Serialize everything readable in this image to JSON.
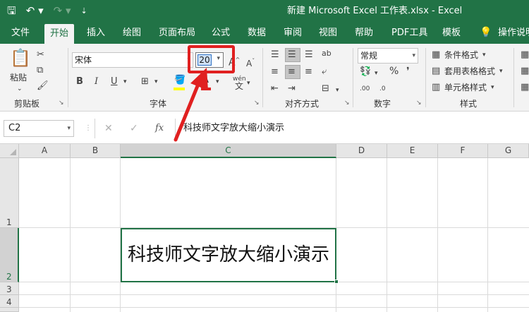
{
  "titlebar": {
    "title": "新建 Microsoft Excel 工作表.xlsx  -  Excel",
    "save_icon": "save-icon",
    "undo_icon": "undo-icon",
    "redo_icon": "redo-icon",
    "customize_icon": "customize-qat-icon"
  },
  "tabs": {
    "file": "文件",
    "home": "开始",
    "insert": "插入",
    "draw": "绘图",
    "layout": "页面布局",
    "formulas": "公式",
    "data": "数据",
    "review": "审阅",
    "view": "视图",
    "help": "帮助",
    "pdf": "PDF工具",
    "templates": "模板",
    "tell_me": "操作说明"
  },
  "ribbon": {
    "clipboard": {
      "paste": "粘贴",
      "label": "剪贴板"
    },
    "font": {
      "font_name": "宋体",
      "font_size": "20",
      "bold": "B",
      "italic": "I",
      "underline": "U",
      "grow": "A",
      "shrink": "A",
      "font_color": "A",
      "phonetic": "wén",
      "label": "字体"
    },
    "alignment": {
      "label": "对齐方式",
      "wrap": "ab"
    },
    "number": {
      "format": "常规",
      "percent": "%",
      "label": "数字",
      "inc_decimal": ".00",
      "dec_decimal": ".0"
    },
    "styles": {
      "conditional": "条件格式",
      "table": "套用表格格式",
      "cell_styles": "单元格样式",
      "label": "样式"
    }
  },
  "formula_bar": {
    "name_box": "C2",
    "cancel": "✕",
    "enter": "✓",
    "fx": "fx",
    "content": "科技师文字放大缩小演示"
  },
  "grid": {
    "columns": [
      "A",
      "B",
      "C",
      "D",
      "E",
      "F",
      "G"
    ],
    "rows": [
      "1",
      "2",
      "3",
      "4"
    ],
    "active_cell_text": "科技师文字放大缩小演示"
  },
  "colors": {
    "excel_green": "#217346",
    "annotation_red": "#e02020"
  }
}
